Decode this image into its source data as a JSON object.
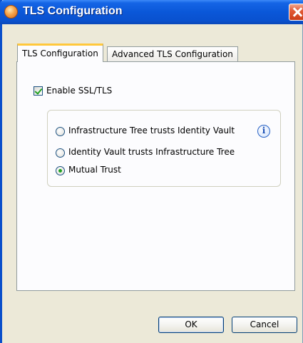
{
  "window": {
    "title": "TLS Configuration"
  },
  "tabs": [
    {
      "label": "TLS Configuration",
      "active": true
    },
    {
      "label": "Advanced TLS Configuration",
      "active": false
    }
  ],
  "enable_ssl": {
    "label": "Enable SSL/TLS",
    "checked": true
  },
  "trust_options": [
    {
      "label": "Infrastructure Tree trusts Identity Vault",
      "selected": false
    },
    {
      "label": "Identity Vault trusts Infrastructure Tree",
      "selected": false
    },
    {
      "label": "Mutual Trust",
      "selected": true
    }
  ],
  "info_icon_glyph": "i",
  "buttons": {
    "ok": "OK",
    "cancel": "Cancel"
  },
  "colors": {
    "title_bar": "#0a57d8",
    "close_button": "#e25a36",
    "check_green": "#21a121",
    "window_bg": "#ece9d8"
  }
}
